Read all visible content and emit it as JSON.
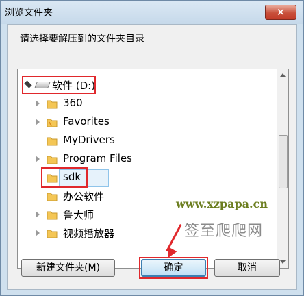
{
  "window": {
    "title": "浏览文件夹",
    "close_label": "✕"
  },
  "instruction": "请选择要解压到的文件夹目录",
  "tree": {
    "root": {
      "label": "软件 (D:)",
      "icon": "drive-icon",
      "expanded": true
    },
    "items": [
      {
        "label": "360",
        "has_children": true
      },
      {
        "label": "Favorites",
        "has_children": true
      },
      {
        "label": "MyDrivers",
        "has_children": false
      },
      {
        "label": "Program Files",
        "has_children": true
      },
      {
        "label": "sdk",
        "has_children": false,
        "selected": true
      },
      {
        "label": "办公软件",
        "has_children": false
      },
      {
        "label": "鲁大师",
        "has_children": true
      },
      {
        "label": "视频播放器",
        "has_children": true
      }
    ]
  },
  "buttons": {
    "new_folder": "新建文件夹(M)",
    "ok": "确定",
    "cancel": "取消"
  },
  "watermark": {
    "url": "www.xzpapa.cn",
    "cn": "签至爬爬网"
  },
  "colors": {
    "highlight_red": "#e0282c",
    "selection": "#e6f2fb",
    "folder_yellow": "#f4c655"
  }
}
